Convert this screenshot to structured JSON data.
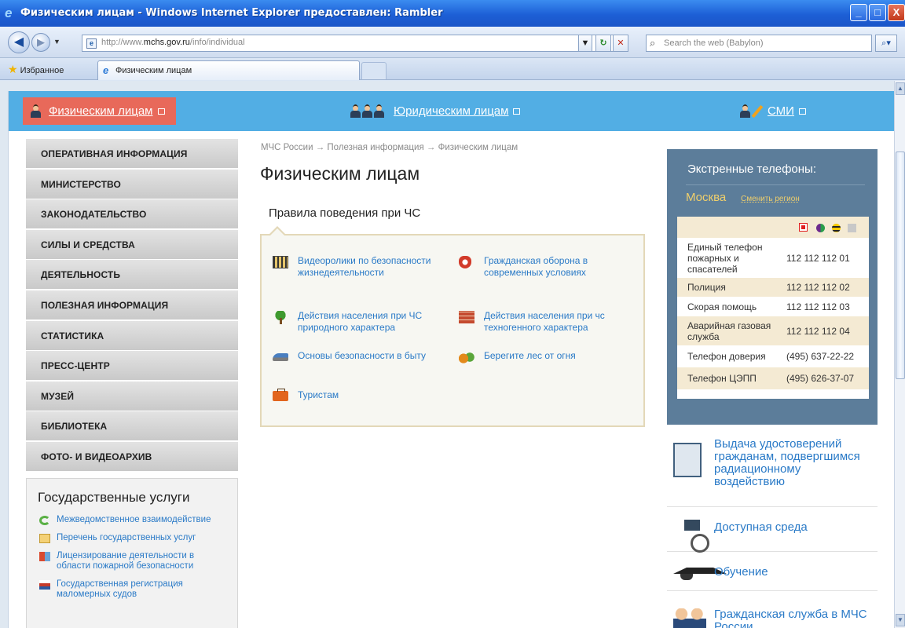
{
  "window": {
    "title": "Физическим лицам - Windows Internet Explorer предоставлен: Rambler",
    "buttons": {
      "minimize": "_",
      "maximize": "□",
      "close": "X"
    }
  },
  "address_bar": {
    "url_prefix": "http://www.",
    "url_host": "mchs.gov.ru",
    "url_path": "/info/individual",
    "search_placeholder": "Search the web (Babylon)"
  },
  "tabs": {
    "favorites_label": "Избранное",
    "active_tab": "Физическим лицам"
  },
  "category_band": {
    "individuals": "Физическим лицам",
    "legal": "Юридическим лицам",
    "media": "СМИ"
  },
  "left_nav": {
    "items": [
      "Оперативная информация",
      "Министерство",
      "Законодательство",
      "Силы и средства",
      "Деятельность",
      "Полезная информация",
      "Статистика",
      "Пресс-центр",
      "Музей",
      "Библиотека",
      "Фото- и видеоархив"
    ]
  },
  "gov_services": {
    "title": "Государственные услуги",
    "items": [
      "Межведомственное взаимодействие",
      "Перечень государственных услуг",
      "Лицензирование деятельности в области пожарной безопасности",
      "Государственная регистрация маломерных судов"
    ]
  },
  "breadcrumb": "МЧС России → Полезная информация → Физическим лицам",
  "page_title": "Физическим лицам",
  "rules": {
    "title": "Правила поведения при ЧС",
    "items": [
      {
        "label": "Видеоролики по безопасности жизнедеятельности",
        "icon": "film-icon"
      },
      {
        "label": "Гражданская оборона в современных условиях",
        "icon": "civil-defense-icon"
      },
      {
        "label": "Действия населения при ЧС природного характера",
        "icon": "tree-icon"
      },
      {
        "label": "Действия населения при чс техногенного характера",
        "icon": "bricks-icon"
      },
      {
        "label": "Основы безопасности в быту",
        "icon": "iron-icon"
      },
      {
        "label": "Берегите лес от огня",
        "icon": "leaves-icon"
      },
      {
        "label": "Туристам",
        "icon": "suitcase-icon"
      }
    ]
  },
  "emergency_phones": {
    "title": "Экстренные телефоны:",
    "city": "Москва",
    "change_region": "Сменить регион",
    "operators": [
      "mts",
      "megafon",
      "beeline",
      "other"
    ],
    "rows": [
      {
        "name": "Единый телефон пожарных и спасателей",
        "number": "112 112 112 01"
      },
      {
        "name": "Полиция",
        "number": "112 112 112 02"
      },
      {
        "name": "Скорая помощь",
        "number": "112 112 112 03"
      },
      {
        "name": "Аварийная газовая служба",
        "number": "112 112 112 04"
      },
      {
        "name": "Телефон доверия",
        "number": "(495) 637-22-22"
      },
      {
        "name": "Телефон ЦЭПП",
        "number": "(495) 626-37-07"
      }
    ]
  },
  "promos": [
    "Выдача удостоверений гражданам, подвергшимся радиационному воздействию",
    "Доступная среда",
    "Обучение",
    "Гражданская служба в МЧС России"
  ],
  "colors": {
    "category_band": "#52aee4",
    "active_category": "#e8695a",
    "link": "#2a7ac7",
    "phone_panel": "#5c7d9a",
    "phone_city": "#f0cf6b"
  }
}
